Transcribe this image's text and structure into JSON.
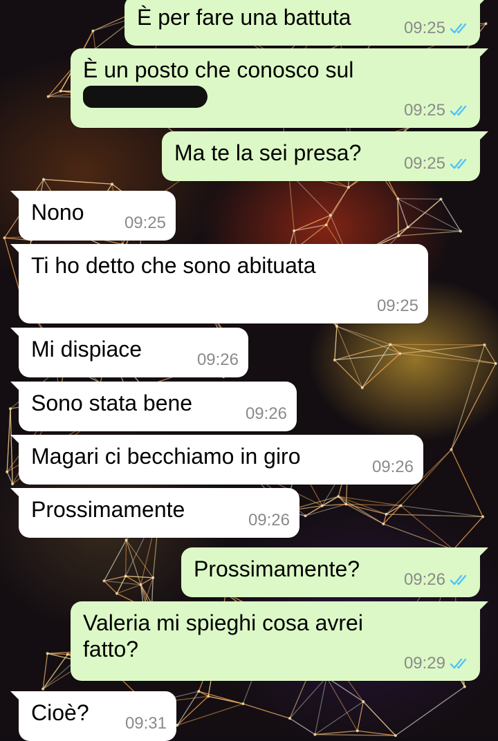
{
  "colors": {
    "outgoing_bubble": "#dcf8c6",
    "incoming_bubble": "#ffffff",
    "read_ticks": "#4fc3f7",
    "timestamp": "#8a8a8a"
  },
  "messages": [
    {
      "direction": "outgoing",
      "text": "È per fare una battuta",
      "time": "09:25",
      "status": "read"
    },
    {
      "direction": "outgoing",
      "text": "È un posto che conosco sul",
      "redacted": true,
      "time": "09:25",
      "status": "read"
    },
    {
      "direction": "outgoing",
      "text": "Ma te la sei presa?",
      "time": "09:25",
      "status": "read"
    },
    {
      "direction": "incoming",
      "text": "Nono",
      "time": "09:25"
    },
    {
      "direction": "incoming",
      "text": "Ti ho detto che sono abituata",
      "time": "09:25"
    },
    {
      "direction": "incoming",
      "text": "Mi dispiace",
      "time": "09:26"
    },
    {
      "direction": "incoming",
      "text": "Sono stata bene",
      "time": "09:26"
    },
    {
      "direction": "incoming",
      "text": "Magari ci becchiamo in giro",
      "time": "09:26"
    },
    {
      "direction": "incoming",
      "text": "Prossimamente",
      "time": "09:26"
    },
    {
      "direction": "outgoing",
      "text": "Prossimamente?",
      "time": "09:26",
      "status": "read"
    },
    {
      "direction": "outgoing",
      "text": "Valeria mi spieghi cosa avrei fatto?",
      "time": "09:29",
      "status": "read"
    },
    {
      "direction": "incoming",
      "text": "Cioè?",
      "time": "09:31"
    }
  ]
}
